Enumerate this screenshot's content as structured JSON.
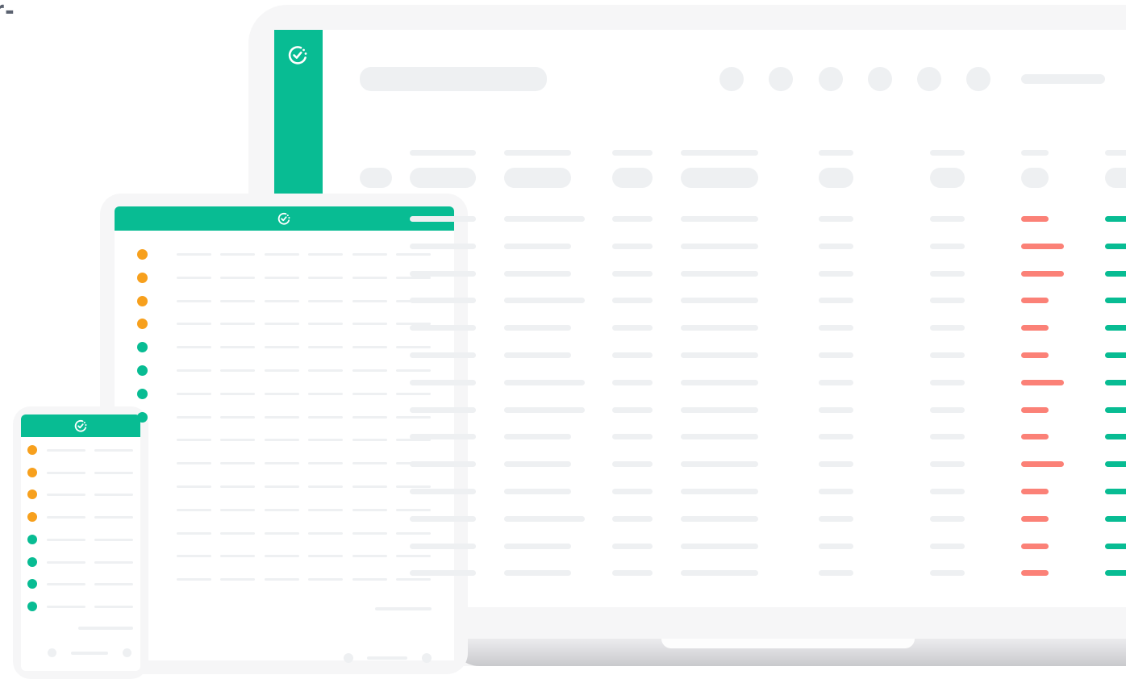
{
  "corner_fragment": "r-",
  "colors": {
    "brand_green": "#08bc93",
    "status_orange": "#f7a01d",
    "status_red": "#fb8177",
    "placeholder_gray": "#eef0f2",
    "device_frame": "#f6f6f7"
  },
  "icons": {
    "app_logo": "clock-check-icon"
  },
  "laptop": {
    "row_count": 14,
    "status_bar_lengths": [
      "short",
      "long",
      "long",
      "short",
      "short",
      "short",
      "long",
      "short",
      "short",
      "long",
      "short",
      "short",
      "short",
      "short"
    ]
  },
  "tablet": {
    "row_statuses": [
      "orange",
      "orange",
      "orange",
      "orange",
      "teal",
      "teal",
      "teal",
      "teal"
    ],
    "row_count": 15
  },
  "phone": {
    "row_statuses": [
      "orange",
      "orange",
      "orange",
      "orange",
      "teal",
      "teal",
      "teal",
      "teal"
    ]
  }
}
